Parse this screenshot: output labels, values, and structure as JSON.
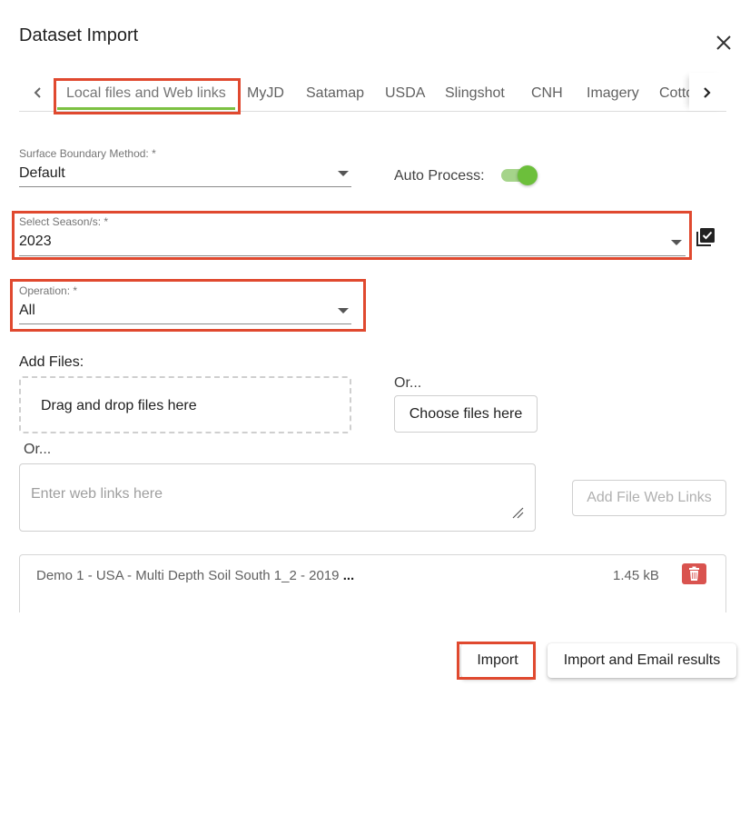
{
  "dialog": {
    "title": "Dataset Import"
  },
  "tabs": [
    {
      "label": "Local files and Web links",
      "active": true
    },
    {
      "label": "MyJD"
    },
    {
      "label": "Satamap"
    },
    {
      "label": "USDA"
    },
    {
      "label": "Slingshot"
    },
    {
      "label": "CNH"
    },
    {
      "label": "Imagery"
    },
    {
      "label": "Cotto"
    }
  ],
  "form": {
    "surface_boundary": {
      "label": "Surface Boundary Method: *",
      "value": "Default"
    },
    "auto_process": {
      "label": "Auto Process:",
      "enabled": true
    },
    "season": {
      "label": "Select Season/s: *",
      "value": "2023"
    },
    "operation": {
      "label": "Operation: *",
      "value": "All"
    }
  },
  "files": {
    "add_label": "Add Files:",
    "dropzone_text": "Drag and drop files here",
    "or_label_1": "Or...",
    "choose_button": "Choose files here",
    "or_label_2": "Or...",
    "weblinks_placeholder": "Enter web links here",
    "add_weblinks_button": "Add File Web Links",
    "list": [
      {
        "name": "Demo 1 - USA - Multi Depth Soil South 1_2 - 2019",
        "ellipsis": "...",
        "size": "1.45 kB"
      }
    ]
  },
  "actions": {
    "import": "Import",
    "import_email": "Import and Email results"
  },
  "colors": {
    "accent_green": "#7cc142",
    "highlight_red": "#e0492f",
    "delete_red": "#d9534f"
  }
}
